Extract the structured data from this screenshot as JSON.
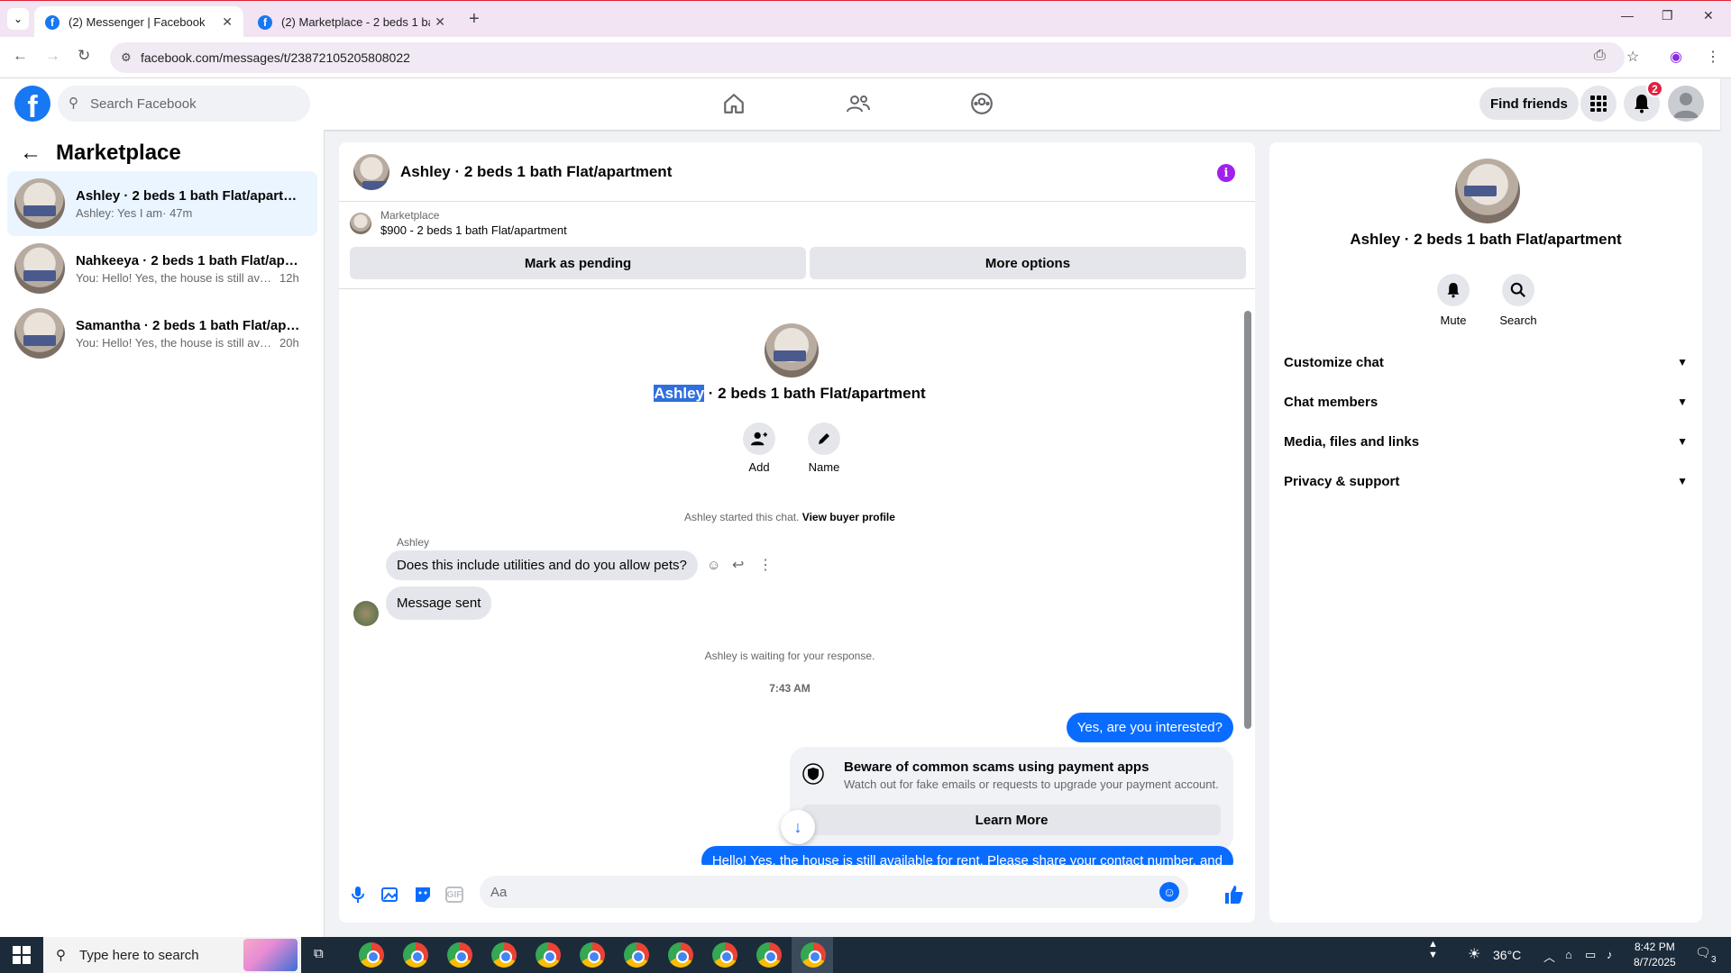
{
  "browser": {
    "tabs": [
      {
        "title": "(2) Messenger | Facebook",
        "active": true
      },
      {
        "title": "(2) Marketplace - 2 beds 1 bath",
        "active": false
      }
    ],
    "url": "facebook.com/messages/t/23872105205808022"
  },
  "fb_header": {
    "logo": "f",
    "search_placeholder": "Search Facebook",
    "find_friends": "Find friends",
    "notif_count": "2"
  },
  "sidebar": {
    "title": "Marketplace",
    "conversations": [
      {
        "name": "Ashley · 2 beds 1 bath Flat/apartm...",
        "preview": "Ashley: Yes I am",
        "time": "· 47m"
      },
      {
        "name": "Nahkeeya · 2 beds 1 bath Flat/apar...",
        "preview": "You: Hello! Yes, the house is still avail...",
        "time": "12h"
      },
      {
        "name": "Samantha · 2 beds 1 bath Flat/apar...",
        "preview": "You: Hello! Yes, the house is still avail...",
        "time": "20h"
      }
    ]
  },
  "chat": {
    "header_title": "Ashley · 2 beds 1 bath Flat/apartment",
    "info_icon": "i",
    "marketplace_label": "Marketplace",
    "listing": "$900 - 2 beds 1 bath Flat/apartment",
    "mark_pending": "Mark as pending",
    "more_options": "More options",
    "intro_name_highlight": "Ashley",
    "intro_name_rest": " · 2 beds 1 bath Flat/apartment",
    "add_label": "Add",
    "name_label": "Name",
    "started_text": "Ashley started this chat.",
    "view_buyer": "View buyer profile",
    "sender": "Ashley",
    "msg1": "Does this include utilities and do you allow pets?",
    "msg2": "Message sent",
    "waiting": "Ashley is waiting for your response.",
    "timestamp": "7:43 AM",
    "reply1": "Yes, are you interested?",
    "scam_title": "Beware of common scams using payment apps",
    "scam_sub": "Watch out for fake emails or requests to upgrade your payment account.",
    "learn_more": "Learn More",
    "reply2": "Hello! Yes, the house is still available for rent. Please share your contact number, and",
    "composer_placeholder": "Aa"
  },
  "right_panel": {
    "title": "Ashley · 2 beds 1 bath Flat/apartment",
    "mute": "Mute",
    "search": "Search",
    "sections": [
      "Customize chat",
      "Chat members",
      "Media, files and links",
      "Privacy & support"
    ]
  },
  "taskbar": {
    "search_placeholder": "Type here to search",
    "temp": "36°C",
    "time": "8:42 PM",
    "date": "8/7/2025",
    "notif": "3"
  },
  "colors": {
    "fb_blue": "#1877f2",
    "messenger_blue": "#0a6cff",
    "info_purple": "#a020f0"
  }
}
